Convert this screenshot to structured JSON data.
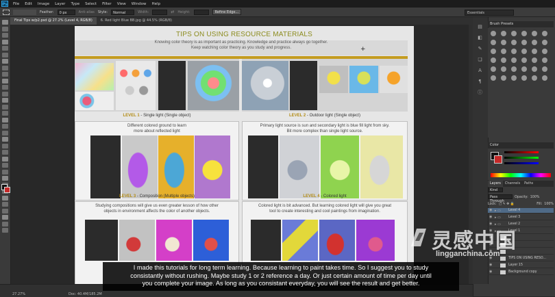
{
  "app": {
    "logo": "Ps"
  },
  "menu": [
    "File",
    "Edit",
    "Image",
    "Layer",
    "Type",
    "Select",
    "Filter",
    "View",
    "Window",
    "Help"
  ],
  "options_bar": {
    "feather_label": "Feather:",
    "feather_value": "0 px",
    "antialias_label": "Anti-alias",
    "style_label": "Style:",
    "style_value": "Normal",
    "width_label": "Width:",
    "height_label": "Height:",
    "refine_edge": "Refine Edge...",
    "workspace": "Essentials"
  },
  "document_tabs": [
    {
      "label": "Final Tips w/p2.psd @ 27.2% (Level 4, RGB/8)",
      "active": true
    },
    {
      "label": "6. Red light Blue BB.jpg @ 44.5% (RGB/8)",
      "active": false
    }
  ],
  "sheet": {
    "title": "TIPS ON USING RESOURCE MATERIALS",
    "intro": [
      "Knowing color theory is as important as practicing. Knowledge and practice always go together.",
      "Keep watching color theory as you study and progress."
    ],
    "levels": [
      {
        "num": "LEVEL 1",
        "name": " - Single light (Single object)"
      },
      {
        "num": "LEVEL 2",
        "name": " - Outdoor light (Single object)"
      },
      {
        "num": "LEVEL 3",
        "name": " - Composition (Multiple objects)"
      },
      {
        "num": "LEVEL 4",
        "name": " - Colored light"
      }
    ],
    "cards": [
      {
        "text": [
          "Different colored ground to learn",
          "more about reflected light"
        ]
      },
      {
        "text": [
          "Primary light source is sun and secondary light is blue fill light from sky.",
          "Bit more complex than single light source."
        ]
      },
      {
        "text": [
          "Studying compositions will give us even greater lesson of how other",
          "objects in environment affects the color of another objects."
        ]
      },
      {
        "text": [
          "Colored light is bit advanced. But learning colored light will give you great",
          "tool to create interesting and cool paintings from imagination."
        ]
      }
    ]
  },
  "panels": {
    "brush_presets": "Brush Presets",
    "color": "Color",
    "layers_tabs": [
      "Layers",
      "Channels",
      "Paths"
    ],
    "kind_label": "Kind",
    "blend_mode": "Pass Through",
    "opacity_label": "Opacity:",
    "opacity_value": "100%",
    "lock_label": "Lock:",
    "fill_label": "Fill:",
    "fill_value": "100%",
    "layers": [
      "Level 4",
      "Level 3",
      "Level 2",
      "Level 1",
      "",
      "",
      "",
      "TIPS ON USING RESO...",
      "Layer 15",
      "Background copy"
    ]
  },
  "status": {
    "zoom": "27.27%",
    "doc": "Doc: 40.4M/185.2M"
  },
  "subtitle": [
    "I made this tutorials for long term learning. Because learning to paint takes time. So I suggest you to study",
    "consistantly without rushing. Maybe study 1 or 2 reference a day. Or just certain amount of time per day until",
    "you complete your image. As long as you consistant everyday, you will see the result and get better."
  ],
  "watermark": {
    "chinese": "灵感中国",
    "url": "lingganchina.com"
  },
  "colors": {
    "accent_yellow": "#c49c20",
    "level_gold": "#b28b14",
    "title_olive": "#8c8c1e"
  }
}
